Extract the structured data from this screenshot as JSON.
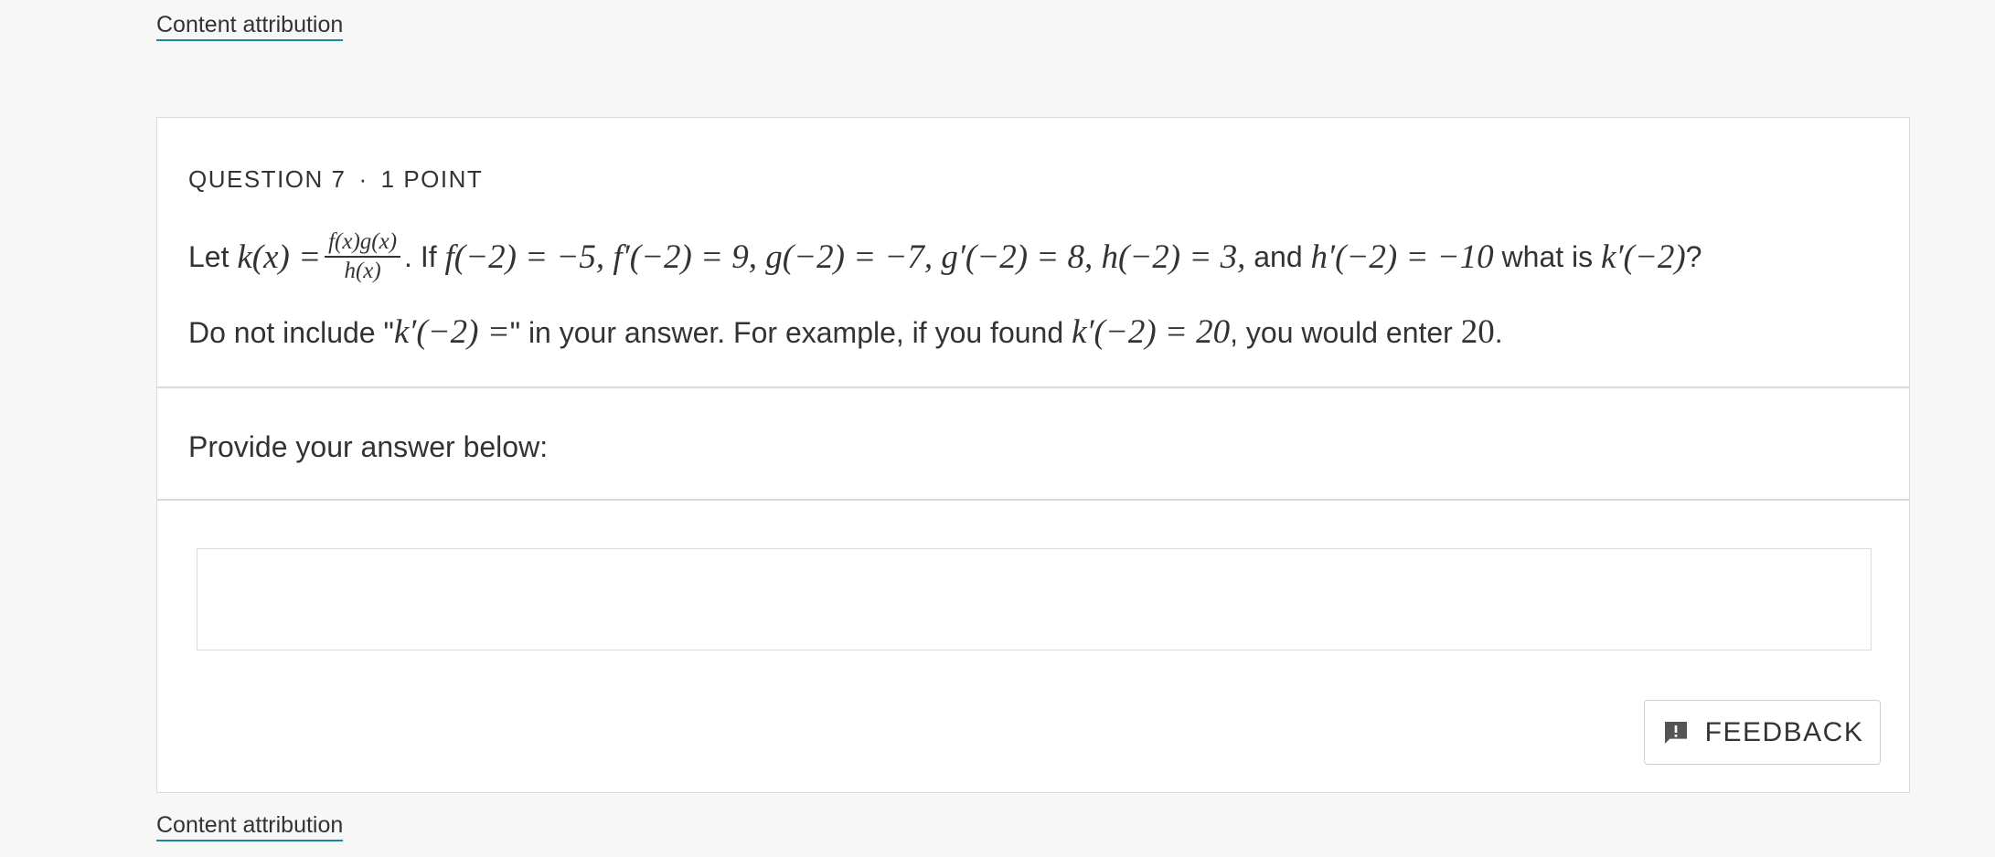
{
  "attribution": {
    "label": "Content attribution"
  },
  "question": {
    "number_label": "QUESTION 7",
    "separator": "·",
    "points_label": "1 POINT",
    "prompt": {
      "let": "Let",
      "k_of_x": "k(x) =",
      "frac_num": "f(x)g(x)",
      "frac_den": "h(x)",
      "period_if": ". If",
      "givens": "f(−2) = −5, f′(−2) = 9, g(−2) = −7, g′(−2) = 8, h(−2) = 3,",
      "and": "and",
      "h_prime": "h′(−2) = −10",
      "what_is": "what is",
      "target": "k′(−2)",
      "qmark": "?"
    },
    "instruction": {
      "part1": "Do not include \"",
      "expr": "k′(−2) =",
      "part2": "\" in your answer. For example, if you found",
      "example": "k′(−2) = 20",
      "part3": ", you would enter",
      "value": "20",
      "end": "."
    }
  },
  "answer": {
    "label": "Provide your answer below:",
    "value": "",
    "placeholder": ""
  },
  "feedback": {
    "label": "FEEDBACK",
    "icon": "feedback-alert-icon"
  }
}
